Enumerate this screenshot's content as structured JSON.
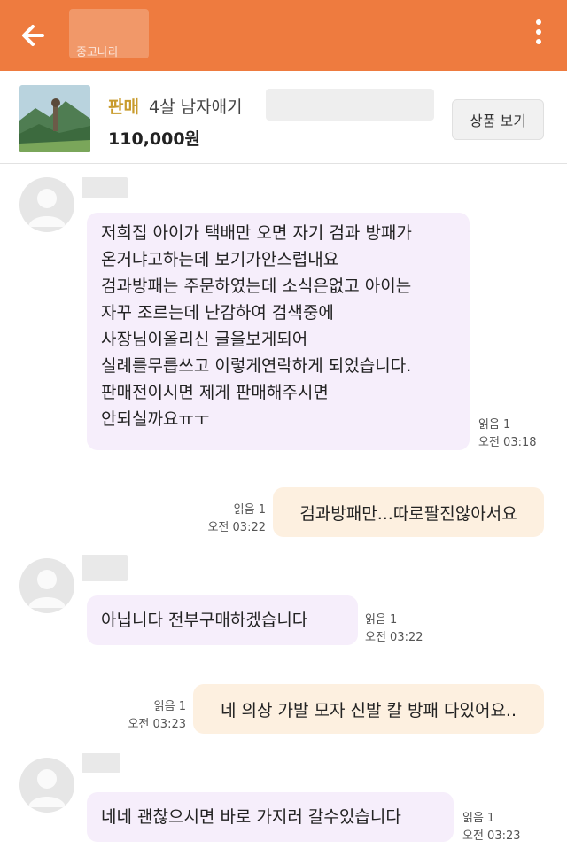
{
  "header": {
    "back_icon": "arrow-left-icon",
    "title_sub": "중고나라",
    "menu_icon": "more-vert-icon",
    "bar_color": "#ee7b3f"
  },
  "product": {
    "sale_tag": "판매",
    "name": "4살 남자애기",
    "price": "110,000원",
    "view_button": "상품 보기"
  },
  "messages": [
    {
      "from": "other",
      "lines": [
        "저희집  아이가 택배만 오면  자기 검과 방패가",
        "온거냐고하는데 보기가안스럽내요",
        "검과방패는  주문하였는데 소식은없고 아이는",
        "자꾸 조르는데 난감하여  검색중에",
        "사장님이올리신  글을보게되어",
        "실례를무릅쓰고  이렇게연락하게 되었습니다.",
        "판매전이시면  제게 판매해주시면",
        "안되실까요ㅠㅜ"
      ],
      "read": "읽음 1",
      "time": "오전 03:18"
    },
    {
      "from": "me",
      "text": "검과방패만...따로팔진않아서요",
      "read": "읽음 1",
      "time": "오전 03:22"
    },
    {
      "from": "other",
      "text": "아닙니다  전부구매하겠습니다",
      "read": "읽음 1",
      "time": "오전 03:22"
    },
    {
      "from": "me",
      "text": "네 의상 가발 모자 신발 칼 방패 다있어요..",
      "read": "읽음 1",
      "time": "오전 03:23"
    },
    {
      "from": "other",
      "text": "네네  괜찮으시면 바로 가지러 갈수있습니다",
      "read": "읽음 1",
      "time": "오전 03:23"
    }
  ]
}
